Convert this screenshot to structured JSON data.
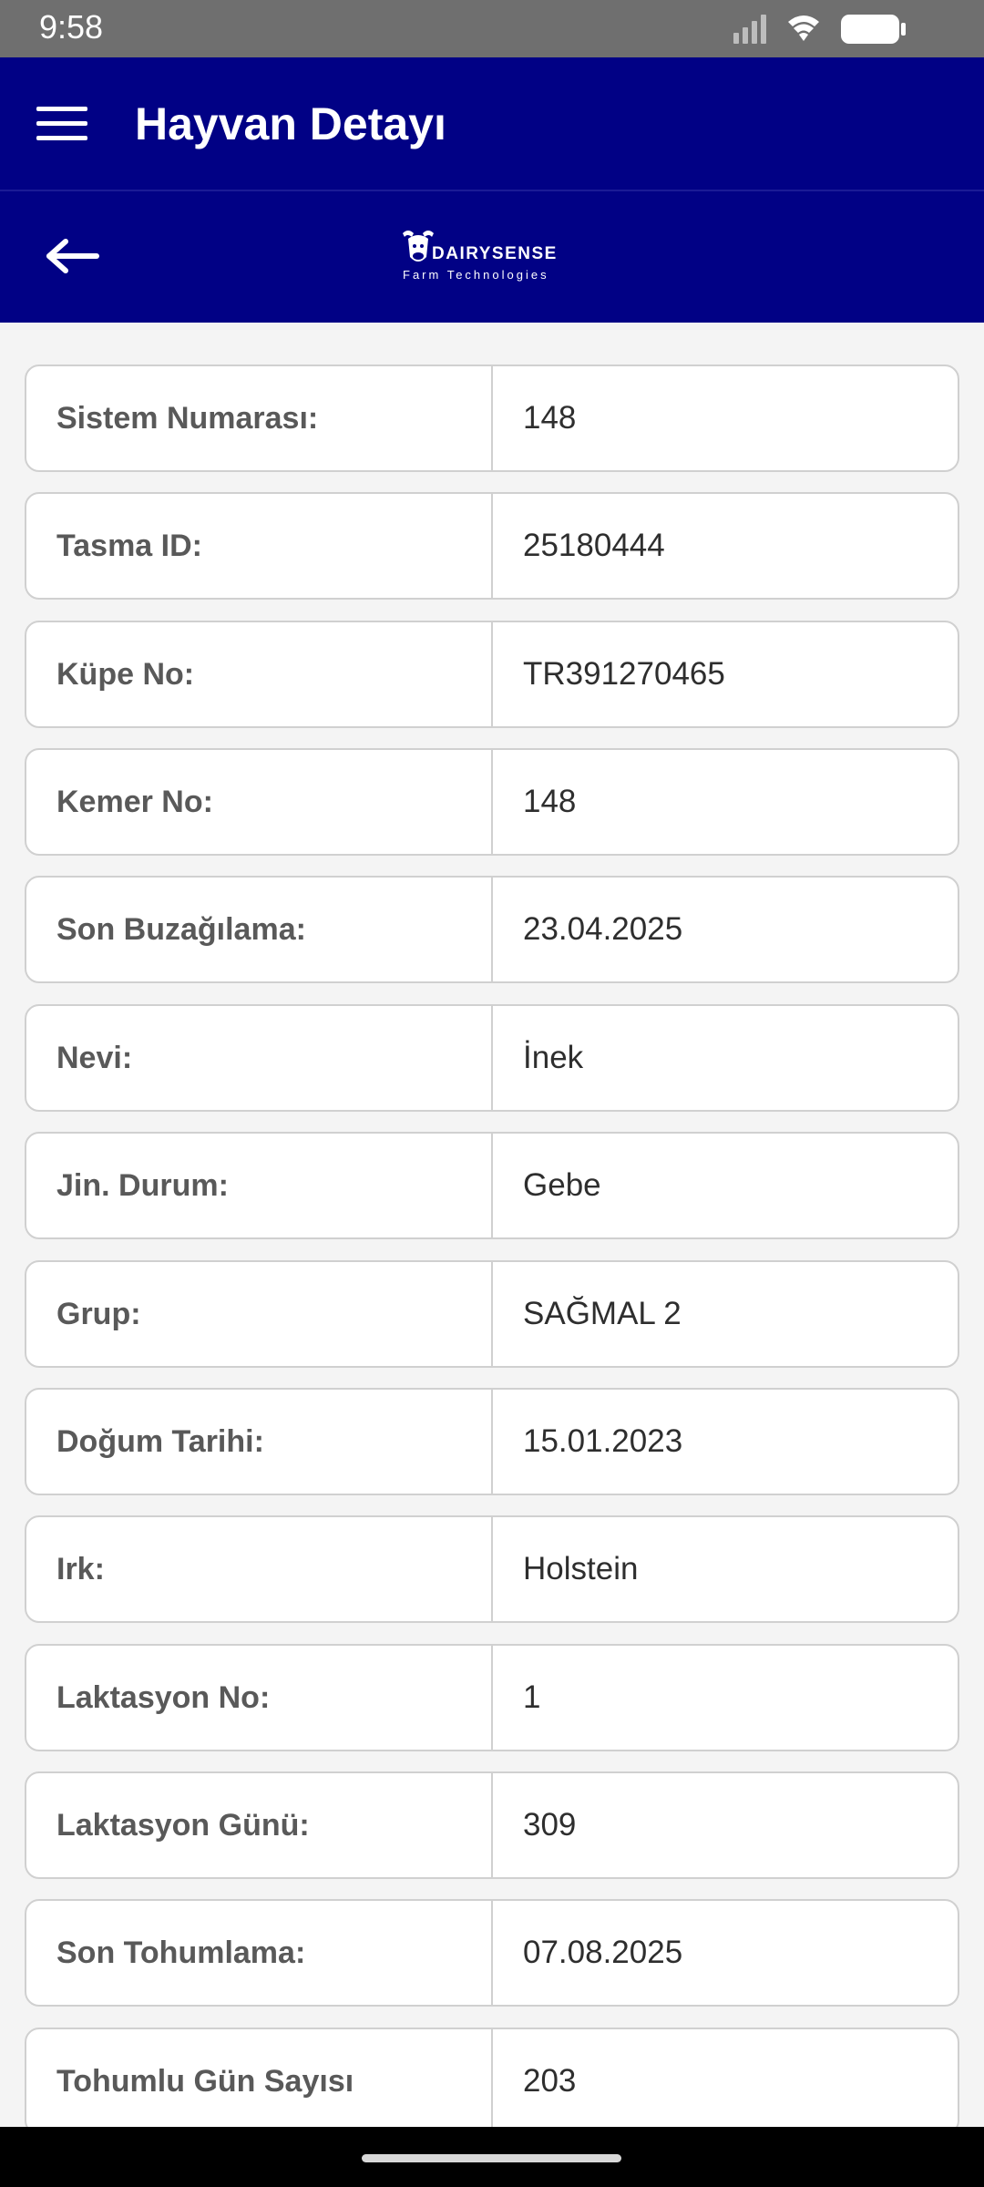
{
  "status_bar": {
    "time": "9:58"
  },
  "header": {
    "title": "Hayvan Detayı"
  },
  "logo": {
    "brand": "DAIRYSENSE",
    "tagline": "Farm Technologies"
  },
  "colors": {
    "primary": "#010185",
    "background": "#f4f4f4",
    "label_text": "#595959",
    "value_text": "#2e2e2e",
    "border": "#d0d0d0"
  },
  "icons": {
    "menu": "menu-icon",
    "back": "back-arrow-icon",
    "signal": "cellular-signal-icon",
    "wifi": "wifi-icon",
    "battery": "battery-icon"
  },
  "details": [
    {
      "label": "Sistem Numarası:",
      "value": "148"
    },
    {
      "label": "Tasma ID:",
      "value": "25180444"
    },
    {
      "label": "Küpe No:",
      "value": "TR391270465"
    },
    {
      "label": "Kemer No:",
      "value": "148"
    },
    {
      "label": "Son Buzağılama:",
      "value": "23.04.2025"
    },
    {
      "label": "Nevi:",
      "value": "İnek"
    },
    {
      "label": "Jin. Durum:",
      "value": "Gebe"
    },
    {
      "label": "Grup:",
      "value": "SAĞMAL 2"
    },
    {
      "label": "Doğum Tarihi:",
      "value": "15.01.2023"
    },
    {
      "label": "Irk:",
      "value": "Holstein"
    },
    {
      "label": "Laktasyon No:",
      "value": "1"
    },
    {
      "label": "Laktasyon Günü:",
      "value": "309"
    },
    {
      "label": "Son Tohumlama:",
      "value": "07.08.2025"
    },
    {
      "label": "Tohumlu Gün Sayısı",
      "value": "203"
    }
  ]
}
